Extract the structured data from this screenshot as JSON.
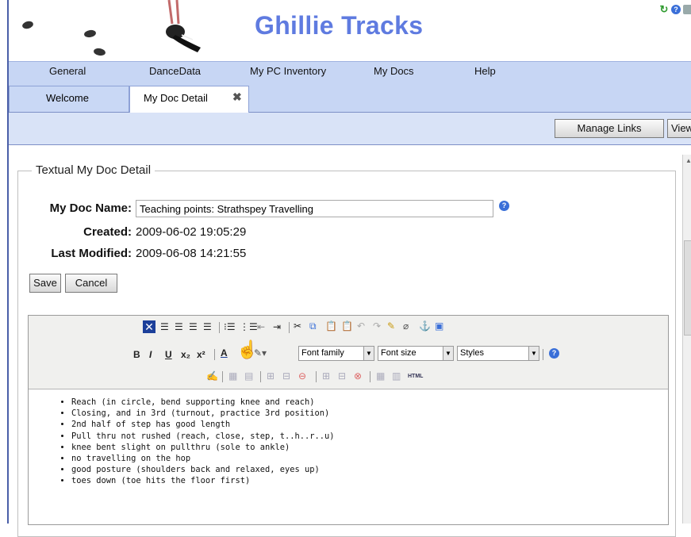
{
  "app": {
    "title": "Ghillie Tracks"
  },
  "menu": [
    "General",
    "DanceData",
    "My PC Inventory",
    "My Docs",
    "Help"
  ],
  "tabs": [
    {
      "label": "Welcome",
      "active": false
    },
    {
      "label": "My Doc Detail",
      "active": true,
      "closable": true
    }
  ],
  "toolbar": {
    "manage_links": "Manage Links",
    "view": "View"
  },
  "form": {
    "legend": "Textual My Doc Detail",
    "name_label": "My Doc Name:",
    "name_value": "Teaching points: Strathspey Travelling",
    "created_label": "Created:",
    "created_value": "2009-06-02 19:05:29",
    "modified_label": "Last Modified:",
    "modified_value": "2009-06-08 14:21:55",
    "save_label": "Save",
    "cancel_label": "Cancel"
  },
  "editor": {
    "font_family": "Font family",
    "font_size": "Font size",
    "styles": "Styles",
    "html_label": "HTML",
    "items": [
      "Reach (in circle, bend supporting knee and reach)",
      "Closing, and in 3rd (turnout, practice 3rd position)",
      "2nd half of step has good length",
      "Pull thru not rushed (reach, close, step, t..h..r..u)",
      "knee bent slight on pullthru (sole to ankle)",
      "no travelling on the hop",
      "good posture (shoulders back and relaxed, eyes up)",
      "toes down (toe hits the floor first)"
    ]
  },
  "colors": {
    "title": "#5f7be0",
    "menubar": "#c7d6f4",
    "accent": "#3a6fd8"
  }
}
